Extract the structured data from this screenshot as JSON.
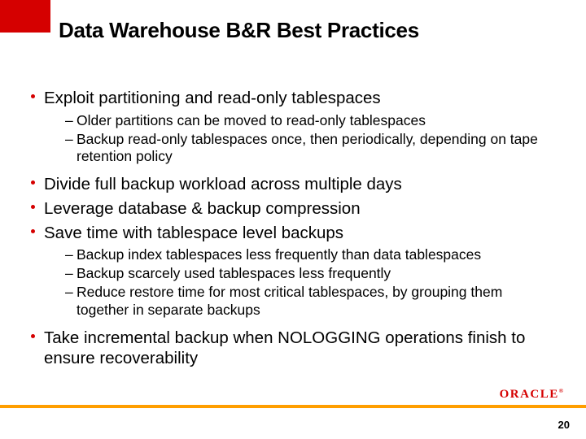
{
  "title": "Data Warehouse B&R Best Practices",
  "bullets": {
    "b1": "Exploit partitioning and read-only tablespaces",
    "b1s1": "Older partitions can be moved to read-only tablespaces",
    "b1s2": "Backup read-only tablespaces once, then periodically, depending on tape retention policy",
    "b2": "Divide full backup workload across multiple days",
    "b3": "Leverage database & backup compression",
    "b4": "Save time with tablespace level backups",
    "b4s1": "Backup index tablespaces less frequently than data tablespaces",
    "b4s2": "Backup scarcely used tablespaces less frequently",
    "b4s3": "Reduce restore time for most critical tablespaces, by grouping them together in separate backups",
    "b5": "Take incremental backup when NOLOGGING operations finish to ensure recoverability"
  },
  "logo": "ORACLE",
  "page": "20"
}
